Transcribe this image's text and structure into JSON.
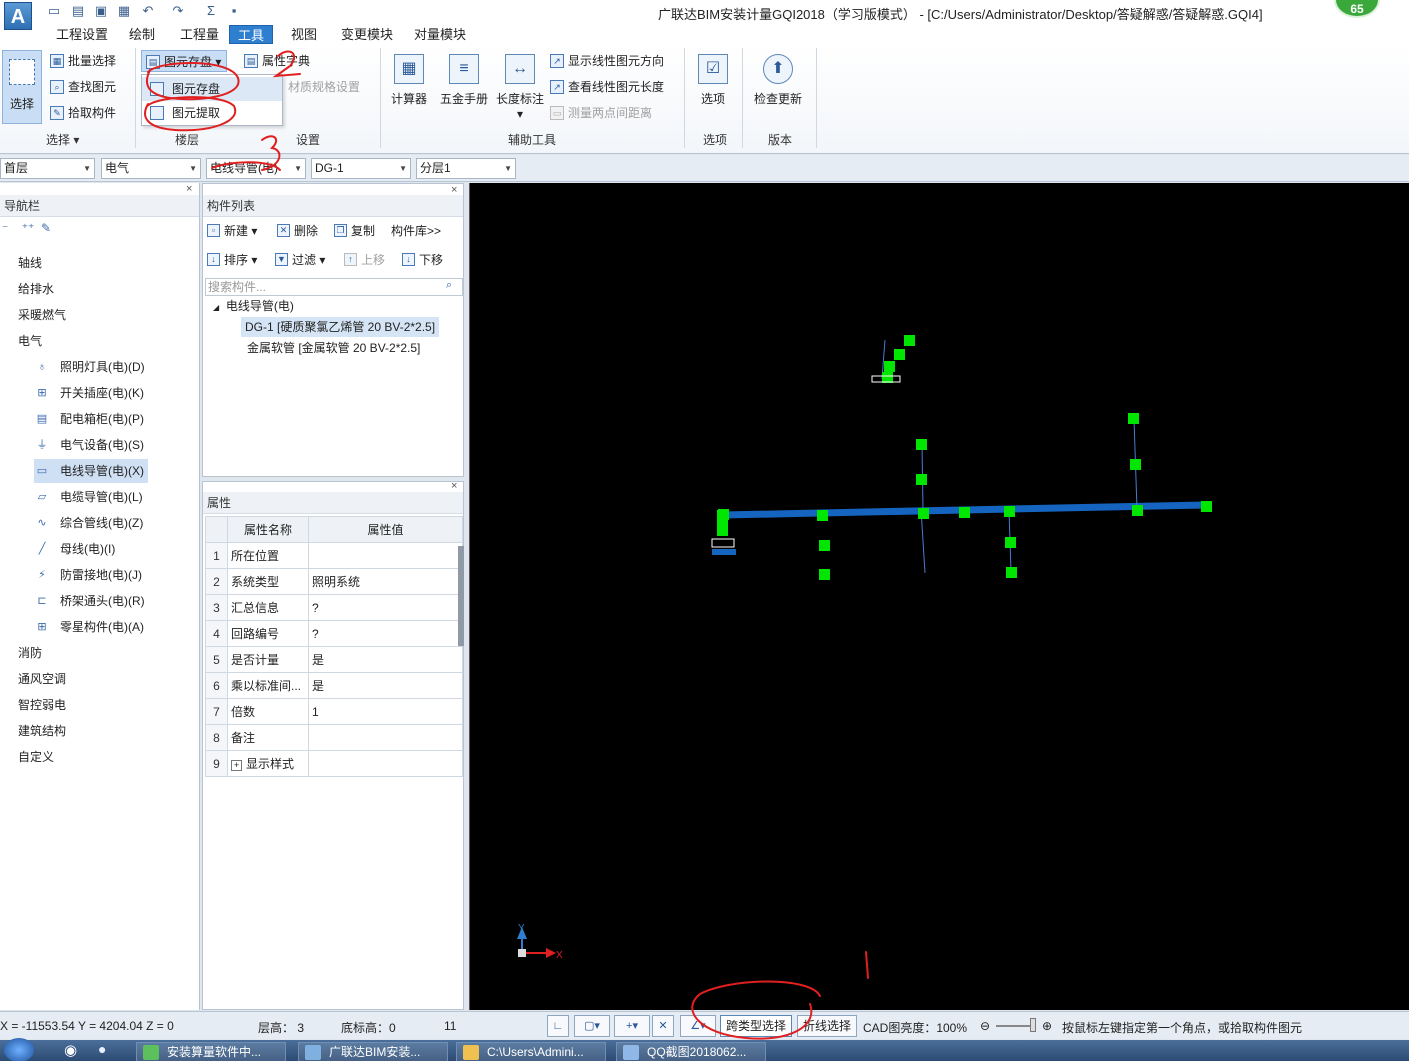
{
  "app": {
    "logo": "A",
    "title": "广联达BIM安装计量GQI2018（学习版模式） - [C:/Users/Administrator/Desktop/答疑解惑/答疑解惑.GQI4]",
    "badge": "65"
  },
  "quick_access": [
    "new-file-icon",
    "open-icon",
    "save-as-icon",
    "bim-icon",
    "undo-icon",
    "redo-icon",
    "sum-icon",
    "save-icon"
  ],
  "menu_tabs": [
    "工程设置",
    "绘制",
    "工程量",
    "工具",
    "视图",
    "变更模块",
    "对量模块"
  ],
  "active_tab": "工具",
  "ribbon": {
    "select_group": {
      "big": "选择",
      "items": [
        "批量选择",
        "查找图元",
        "拾取构件"
      ],
      "label": "选择 ▾"
    },
    "floor_group": {
      "dropdown": "图元存盘",
      "menu": [
        "图元存盘",
        "图元提取"
      ],
      "label": "楼层"
    },
    "settings_group": {
      "items": [
        "属性字典",
        "材质规格设置"
      ],
      "label": "设置"
    },
    "aux_group": {
      "big": [
        "计算器",
        "五金手册",
        "长度标注"
      ],
      "items": [
        "显示线性图元方向",
        "查看线性图元长度",
        "测量两点间距离"
      ],
      "label": "辅助工具"
    },
    "options_group": {
      "big": "选项",
      "label": "选项"
    },
    "version_group": {
      "big": "检查更新",
      "label": "版本"
    }
  },
  "selectors": {
    "floor": "首层",
    "discipline": "电气",
    "type": "电线导管(电)",
    "component": "DG-1",
    "sublayer": "分层1"
  },
  "nav": {
    "title": "导航栏",
    "categories": [
      "轴线",
      "给排水",
      "采暖燃气",
      "电气",
      "消防",
      "通风空调",
      "智控弱电",
      "建筑结构",
      "自定义"
    ],
    "electrical_items": [
      "照明灯具(电)(D)",
      "开关插座(电)(K)",
      "配电箱柜(电)(P)",
      "电气设备(电)(S)",
      "电线导管(电)(X)",
      "电缆导管(电)(L)",
      "综合管线(电)(Z)",
      "母线(电)(I)",
      "防雷接地(电)(J)",
      "桥架通头(电)(R)",
      "零星构件(电)(A)"
    ]
  },
  "component_list": {
    "title": "构件列表",
    "toolbar1": [
      "新建",
      "删除",
      "复制",
      "构件库>>"
    ],
    "toolbar2": [
      "排序",
      "过滤",
      "上移",
      "下移"
    ],
    "search_placeholder": "搜索构件...",
    "tree_root": "电线导管(电)",
    "items": [
      "DG-1 [硬质聚氯乙烯管 20 BV-2*2.5]",
      "金属软管 [金属软管 20 BV-2*2.5]"
    ]
  },
  "properties": {
    "title": "属性",
    "col_name": "属性名称",
    "col_value": "属性值",
    "rows": [
      {
        "n": "1",
        "name": "所在位置",
        "value": ""
      },
      {
        "n": "2",
        "name": "系统类型",
        "value": "照明系统"
      },
      {
        "n": "3",
        "name": "汇总信息",
        "value": "?"
      },
      {
        "n": "4",
        "name": "回路编号",
        "value": "?"
      },
      {
        "n": "5",
        "name": "是否计量",
        "value": "是"
      },
      {
        "n": "6",
        "name": "乘以标准间...",
        "value": "是"
      },
      {
        "n": "7",
        "name": "倍数",
        "value": "1"
      },
      {
        "n": "8",
        "name": "备注",
        "value": ""
      },
      {
        "n": "9",
        "name": "显示样式",
        "value": "",
        "expander": "+"
      }
    ]
  },
  "canvas": {
    "axis_x": "X",
    "axis_y": "Y",
    "colors": {
      "background": "#000000",
      "pipe": "#1565c0",
      "grip": "#00e600"
    }
  },
  "status": {
    "coords": "X = -11553.54 Y = 4204.04 Z = 0",
    "floor_height": "层高： 3",
    "base_height": "底标高：0",
    "count": "11",
    "cross_type_select": "跨类型选择",
    "polyline_select": "折线选择",
    "cad_brightness": "CAD图亮度：100%",
    "hint": "按鼠标左键指定第一个角点，或拾取构件图元"
  },
  "taskbar": [
    "安装算量软件中...",
    "广联达BIM安装...",
    "C:\\Users\\Admini...",
    "QQ截图2018062..."
  ],
  "annotations": [
    "1",
    "2",
    "3"
  ]
}
